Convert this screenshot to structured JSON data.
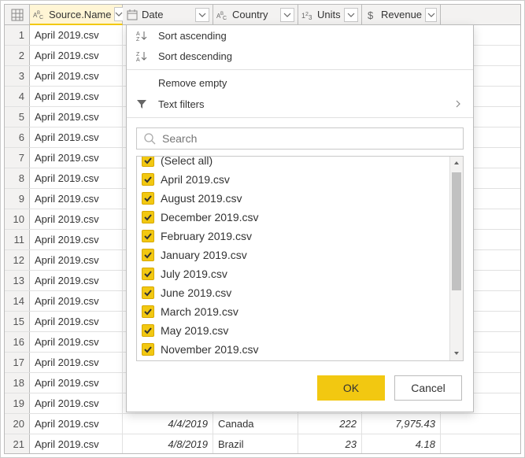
{
  "columns": {
    "source": "Source.Name",
    "date": "Date",
    "country": "Country",
    "units": "Units",
    "revenue": "Revenue"
  },
  "rows": [
    {
      "n": 1,
      "src": "April 2019.csv"
    },
    {
      "n": 2,
      "src": "April 2019.csv"
    },
    {
      "n": 3,
      "src": "April 2019.csv"
    },
    {
      "n": 4,
      "src": "April 2019.csv"
    },
    {
      "n": 5,
      "src": "April 2019.csv"
    },
    {
      "n": 6,
      "src": "April 2019.csv"
    },
    {
      "n": 7,
      "src": "April 2019.csv"
    },
    {
      "n": 8,
      "src": "April 2019.csv"
    },
    {
      "n": 9,
      "src": "April 2019.csv"
    },
    {
      "n": 10,
      "src": "April 2019.csv"
    },
    {
      "n": 11,
      "src": "April 2019.csv"
    },
    {
      "n": 12,
      "src": "April 2019.csv"
    },
    {
      "n": 13,
      "src": "April 2019.csv"
    },
    {
      "n": 14,
      "src": "April 2019.csv"
    },
    {
      "n": 15,
      "src": "April 2019.csv"
    },
    {
      "n": 16,
      "src": "April 2019.csv"
    },
    {
      "n": 17,
      "src": "April 2019.csv"
    },
    {
      "n": 18,
      "src": "April 2019.csv"
    },
    {
      "n": 19,
      "src": "April 2019.csv"
    },
    {
      "n": 20,
      "src": "April 2019.csv",
      "date": "4/4/2019",
      "country": "Canada",
      "units": "222",
      "rev": "7,975.43"
    },
    {
      "n": 21,
      "src": "April 2019.csv",
      "date": "4/8/2019",
      "country": "Brazil",
      "units": "23",
      "rev": "4.18"
    }
  ],
  "menu": {
    "sort_asc": "Sort ascending",
    "sort_desc": "Sort descending",
    "remove_empty": "Remove empty",
    "text_filters": "Text filters"
  },
  "search": {
    "placeholder": "Search"
  },
  "filter_items": [
    "(Select all)",
    "April 2019.csv",
    "August 2019.csv",
    "December 2019.csv",
    "February 2019.csv",
    "January 2019.csv",
    "July 2019.csv",
    "June 2019.csv",
    "March 2019.csv",
    "May 2019.csv",
    "November 2019.csv"
  ],
  "buttons": {
    "ok": "OK",
    "cancel": "Cancel"
  }
}
